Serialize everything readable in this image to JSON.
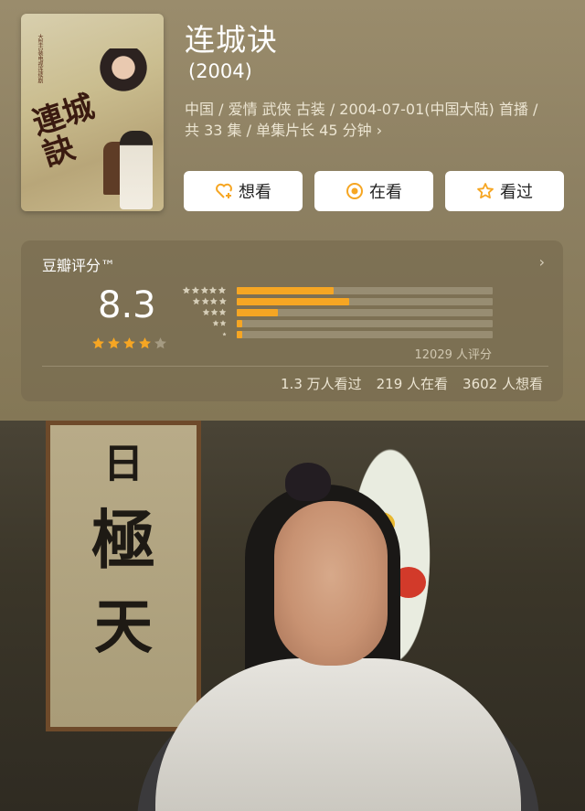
{
  "movie": {
    "title": "连城诀",
    "year": "(2004)",
    "meta_line1": "中国 / 爱情 武侠 古装 / 2004-07-01(中国大陆) 首播 /",
    "meta_line2": "共 33 集 / 单集片长 45 分钟",
    "poster": {
      "title": "連城訣",
      "tagline": "大型古装电视连续剧"
    }
  },
  "actions": {
    "want": "想看",
    "watching": "在看",
    "watched": "看过"
  },
  "rating": {
    "label": "豆瓣评分™",
    "score": "8.3",
    "stars_filled": 4,
    "stars_total": 5,
    "distribution_percent": {
      "5": 38,
      "4": 44,
      "3": 16,
      "2": 2,
      "1": 1
    },
    "count": "12029 人评分",
    "stats": [
      "1.3 万人看过",
      "219 人在看",
      "3602 人想看"
    ]
  },
  "still": {
    "plaque_text": [
      "日",
      "極",
      "天"
    ]
  },
  "colors": {
    "accent": "#f6a623",
    "background": "#8d8062"
  }
}
